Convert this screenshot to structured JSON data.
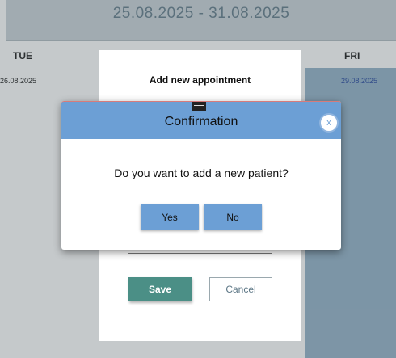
{
  "calendar": {
    "range": "25.08.2025 - 31.08.2025",
    "days": [
      {
        "name": "TUE",
        "date": "26.08.2025"
      },
      {
        "name": "FRI",
        "date": "29.08.2025"
      }
    ]
  },
  "appointment": {
    "title": "Add new appointment",
    "save_label": "Save",
    "cancel_label": "Cancel"
  },
  "confirm": {
    "title": "Confirmation",
    "close_label": "x",
    "message": "Do you want to add a new patient?",
    "yes_label": "Yes",
    "no_label": "No"
  },
  "colors": {
    "header_blue": "#6c9fd5",
    "save_green": "#4b8f86",
    "selected_day": "#8fb0c6"
  }
}
